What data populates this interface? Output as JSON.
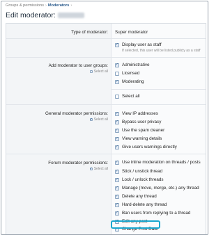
{
  "breadcrumb": {
    "parent": "Groups & permissions",
    "current": "Moderators"
  },
  "page_title": "Edit moderator:",
  "type_row": {
    "label": "Type of moderator:",
    "value": "Super moderator"
  },
  "staff": {
    "label": "Display user as staff",
    "hint": "If selected, this user will be listed publicly as a staff",
    "checked": true
  },
  "groups": {
    "label": "Add moderator to user groups:",
    "select_all": "Select all",
    "items": [
      {
        "label": "Administrative",
        "checked": true
      },
      {
        "label": "Licensed",
        "checked": false
      },
      {
        "label": "Moderating",
        "checked": true
      }
    ],
    "bottom_select_all": "Select all"
  },
  "general": {
    "label": "General moderator permissions:",
    "select_all": "Select all",
    "items": [
      {
        "label": "View IP addresses",
        "checked": true
      },
      {
        "label": "Bypass user privacy",
        "checked": true
      },
      {
        "label": "Use the spam cleaner",
        "checked": true
      },
      {
        "label": "View warning details",
        "checked": true
      },
      {
        "label": "Give users warnings directly",
        "checked": true
      }
    ]
  },
  "forum": {
    "label": "Forum moderator permissions:",
    "select_all": "Select all",
    "items": [
      {
        "label": "Use inline moderation on threads / posts",
        "checked": true
      },
      {
        "label": "Stick / unstick thread",
        "checked": true
      },
      {
        "label": "Lock / unlock threads",
        "checked": true
      },
      {
        "label": "Manage (move, merge, etc.) any thread",
        "checked": true
      },
      {
        "label": "Delete any thread",
        "checked": true
      },
      {
        "label": "Hard-delete any thread",
        "checked": true
      },
      {
        "label": "Ban users from replying to a thread",
        "checked": true
      },
      {
        "label": "Edit any post",
        "checked": true
      },
      {
        "label": "Change Post Date",
        "checked": true
      }
    ]
  },
  "colors": {
    "accent": "#1aa7cf",
    "link": "#2a5a8c"
  }
}
